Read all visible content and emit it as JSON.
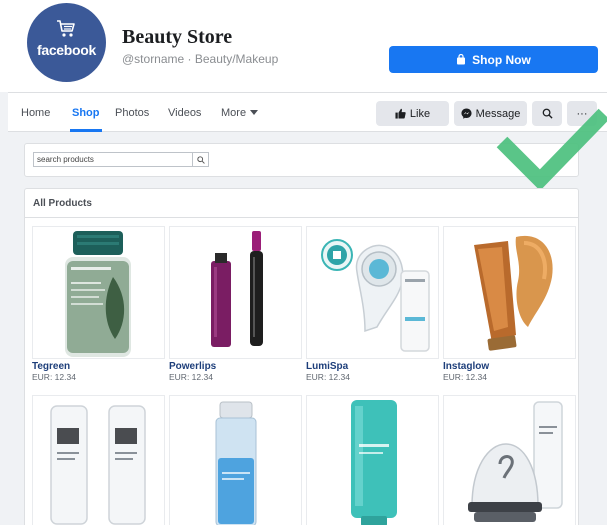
{
  "header": {
    "logo_text": "facebook",
    "store_name": "Beauty Store",
    "store_subtitle": "@storname · Beauty/Makeup",
    "shop_now_label": "Shop Now"
  },
  "nav": {
    "tabs": [
      {
        "label": "Home",
        "active": false
      },
      {
        "label": "Shop",
        "active": true
      },
      {
        "label": "Photos",
        "active": false
      },
      {
        "label": "Videos",
        "active": false
      },
      {
        "label": "More",
        "active": false
      }
    ],
    "like_label": "Like",
    "message_label": "Message",
    "more_label": "···"
  },
  "search": {
    "placeholder": "search products",
    "value": ""
  },
  "products": {
    "title": "All Products",
    "items": [
      {
        "name": "Tegreen",
        "price": "EUR: 12.34"
      },
      {
        "name": "Powerlips",
        "price": "EUR: 12.34"
      },
      {
        "name": "LumiSpa",
        "price": "EUR: 12.34"
      },
      {
        "name": "Instaglow",
        "price": "EUR: 12.34"
      }
    ]
  },
  "colors": {
    "brand_blue": "#1877f2",
    "logo_blue": "#3b5998",
    "checkmark_green": "#4cc07e"
  }
}
